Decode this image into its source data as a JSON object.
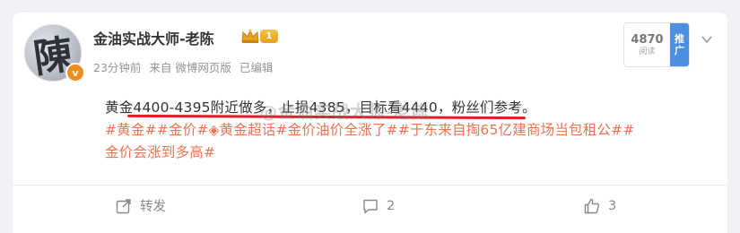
{
  "post": {
    "username": "金油实战大师-老陈",
    "level_badge": "1",
    "avatar_char": "陳",
    "verified_mark": "v",
    "time": "23分钟前",
    "source": "来自 微博网页版",
    "edited": "已编辑",
    "text": "黄金4400-4395附近做多，止损4385，目标看4440，粉丝们参考。",
    "tags_line1": "#黄金##金价#◈黄金超话#金价油价全涨了##于东来自掏65亿建商场当包租公##",
    "tags_line2": "金价会涨到多高#",
    "watermark": "@金油实战大师-老陈"
  },
  "recommend": {
    "count": "4870",
    "sub": "阅读",
    "label_line1": "推",
    "label_line2": "广"
  },
  "actions": {
    "repost_label": "转发",
    "comment_count": "2",
    "like_count": "3"
  },
  "colors": {
    "tag": "#eb7350",
    "underline": "#e01e28",
    "badge": "#f08c1b",
    "promo": "#4a8fe0"
  }
}
